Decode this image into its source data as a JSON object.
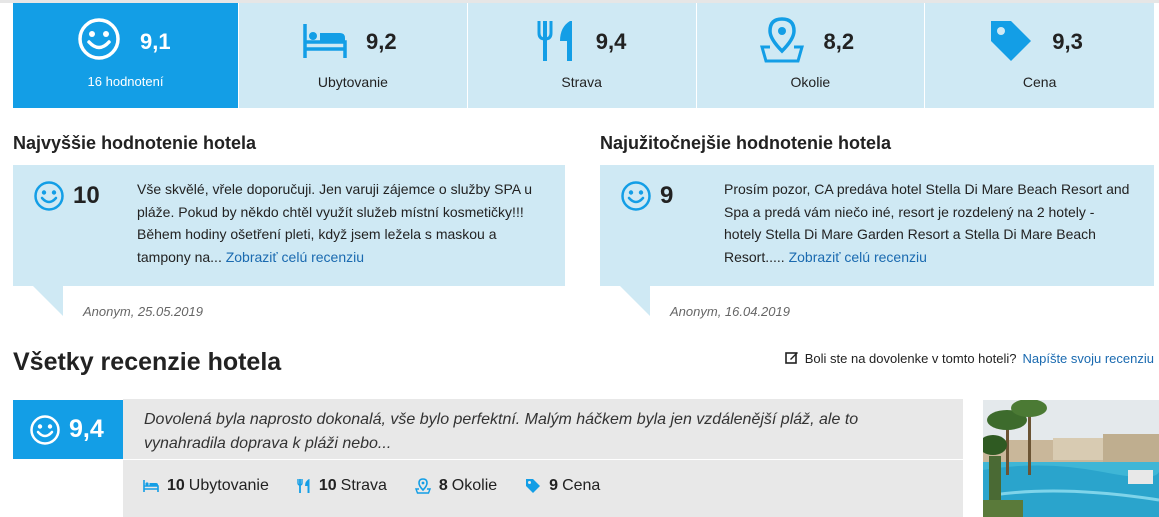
{
  "rating_bar": {
    "overall": {
      "score": "9,1",
      "count_label": "16 hodnotení"
    },
    "categories": [
      {
        "score": "9,2",
        "label": "Ubytovanie",
        "icon": "bed-icon"
      },
      {
        "score": "9,4",
        "label": "Strava",
        "icon": "fork-knife-icon"
      },
      {
        "score": "8,2",
        "label": "Okolie",
        "icon": "map-pin-icon"
      },
      {
        "score": "9,3",
        "label": "Cena",
        "icon": "price-tag-icon"
      }
    ]
  },
  "highest": {
    "title": "Najvyššie hodnotenie hotela",
    "score": "10",
    "text": "Vše skvělé, vřele doporučuji. Jen varuji zájemce o služby SPA u pláže. Pokud by někdo chtěl využít služeb místní kosmetičky!!! Během hodiny ošetření pleti, když jsem ležela s maskou a tampony na...",
    "link": "Zobraziť celú recenziu",
    "meta": "Anonym, 25.05.2019"
  },
  "most_useful": {
    "title": "Najužitočnejšie hodnotenie hotela",
    "score": "9",
    "text": "Prosím pozor, CA predáva hotel Stella Di Mare Beach Resort and Spa a predá vám niečo iné, resort je rozdelený na 2 hotely - hotely Stella Di Mare Garden Resort a Stella Di Mare Beach Resort.....",
    "link": "Zobraziť celú recenziu",
    "meta": "Anonym, 16.04.2019"
  },
  "all_reviews": {
    "title": "Všetky recenzie hotela",
    "prompt": "Boli ste na dovolenke v tomto hoteli?",
    "prompt_link": "Napíšte svoju recenziu"
  },
  "review": {
    "score": "9,4",
    "text": "Dovolená byla naprosto dokonalá, vše bylo perfektní. Malým háčkem byla jen vzdálenější pláž, ale to vynahradila doprava k pláži nebo...",
    "categories": [
      {
        "score": "10",
        "label": "Ubytovanie",
        "icon": "bed-icon"
      },
      {
        "score": "10",
        "label": "Strava",
        "icon": "fork-knife-icon"
      },
      {
        "score": "8",
        "label": "Okolie",
        "icon": "map-pin-icon"
      },
      {
        "score": "9",
        "label": "Cena",
        "icon": "price-tag-icon"
      }
    ]
  },
  "colors": {
    "accent": "#139ee6",
    "panel": "#cfe9f4",
    "link": "#1a6ab0",
    "review_bg": "#e8e8e8"
  }
}
